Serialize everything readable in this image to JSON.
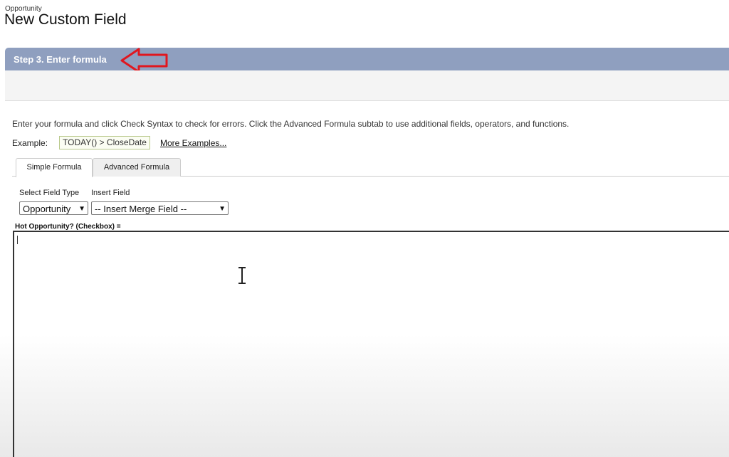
{
  "header": {
    "object_label": "Opportunity",
    "page_title": "New Custom Field"
  },
  "step": {
    "label": "Step 3. Enter formula",
    "header_color": "#8f9fbf",
    "annotation_arrow_color": "#e0171f"
  },
  "instructions": "Enter your formula and click Check Syntax to check for errors. Click the Advanced Formula subtab to use additional fields, operators, and functions.",
  "example": {
    "label": "Example:",
    "code": "TODAY() > CloseDate",
    "more_link": "More Examples..."
  },
  "tabs": [
    {
      "label": "Simple Formula",
      "active": true
    },
    {
      "label": "Advanced Formula",
      "active": false
    }
  ],
  "selectors": {
    "field_type_label": "Select Field Type",
    "field_type_value": "Opportunity",
    "insert_field_label": "Insert Field",
    "insert_field_value": "-- Insert Merge Field --"
  },
  "formula": {
    "label": "Hot Opportunity? (Checkbox) =",
    "value": ""
  },
  "icons": {
    "annotation": "red-outline-arrow-left-icon",
    "cursor": "text-cursor-icon",
    "dropdown": "chevron-down-icon"
  }
}
